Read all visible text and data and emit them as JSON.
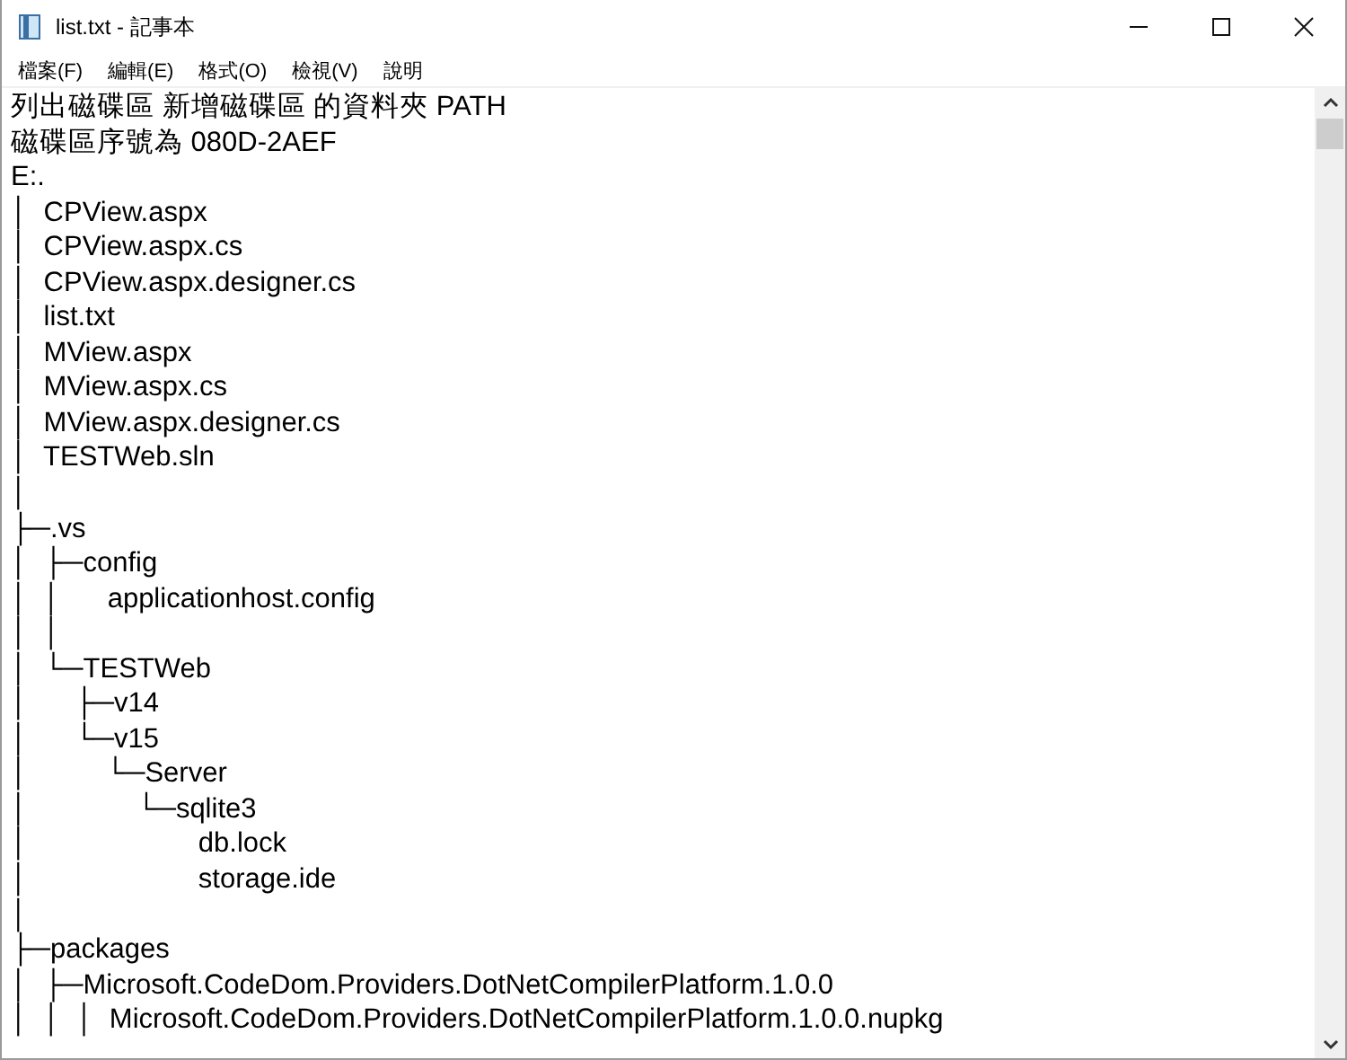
{
  "window": {
    "title": "list.txt - 記事本"
  },
  "menu": [
    {
      "label": "檔案(F)"
    },
    {
      "label": "編輯(E)"
    },
    {
      "label": "格式(O)"
    },
    {
      "label": "檢視(V)"
    },
    {
      "label": "說明"
    }
  ],
  "editor": {
    "lines": [
      "列出磁碟區 新增磁碟區 的資料夾 PATH",
      "磁碟區序號為 080D-2AEF",
      "E:.",
      "│  CPView.aspx",
      "│  CPView.aspx.cs",
      "│  CPView.aspx.designer.cs",
      "│  list.txt",
      "│  MView.aspx",
      "│  MView.aspx.cs",
      "│  MView.aspx.designer.cs",
      "│  TESTWeb.sln",
      "│",
      "├─.vs",
      "│  ├─config",
      "│  │      applicationhost.config",
      "│  │",
      "│  └─TESTWeb",
      "│      ├─v14",
      "│      └─v15",
      "│          └─Server",
      "│              └─sqlite3",
      "│                      db.lock",
      "│                      storage.ide",
      "│",
      "├─packages",
      "│  ├─Microsoft.CodeDom.Providers.DotNetCompilerPlatform.1.0.0",
      "│  │  │  Microsoft.CodeDom.Providers.DotNetCompilerPlatform.1.0.0.nupkg"
    ]
  }
}
